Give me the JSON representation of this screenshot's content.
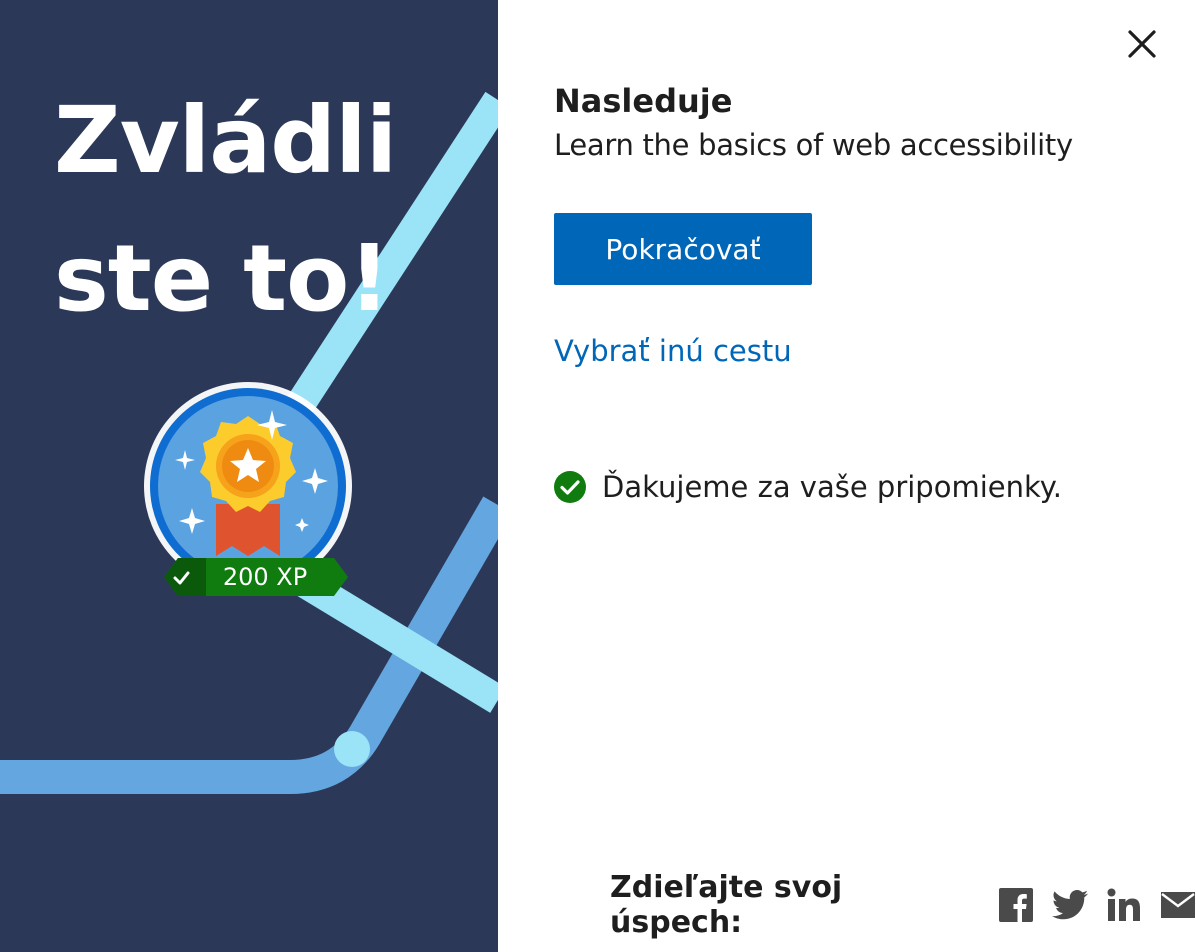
{
  "hero": {
    "headline": "Zvládli ste to!",
    "badge_icon": "achievement-badge-icon",
    "xp_label": "200 XP"
  },
  "dialog": {
    "close_icon": "close-icon",
    "next_heading": "Nasleduje",
    "next_module_title": "Learn the basics of web accessibility",
    "continue_label": "Pokračovať",
    "other_path_label": "Vybrať inú cestu",
    "feedback_message": "Ďakujeme za vaše pripomienky.",
    "feedback_icon": "success-check-icon"
  },
  "share": {
    "label": "Zdieľajte svoj úspech:",
    "icons": [
      "facebook-icon",
      "twitter-icon",
      "linkedin-icon",
      "email-icon"
    ]
  },
  "colors": {
    "hero_bg": "#2b3858",
    "accent": "#0067b8",
    "success": "#107c10",
    "path_light": "#9be3f7",
    "path_mid": "#63a6e0"
  }
}
